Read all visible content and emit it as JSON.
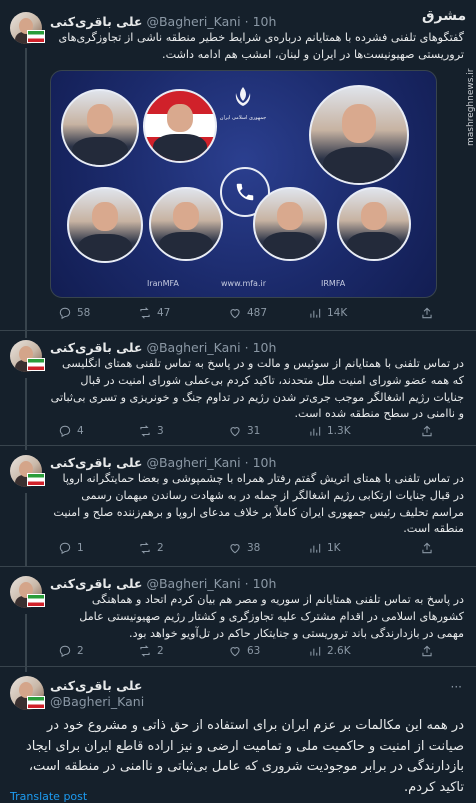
{
  "watermark": {
    "logo_text": "مشرق",
    "site": "mashreghnews.ir"
  },
  "tweets": [
    {
      "name": "علی باقری‌کنی",
      "handle": "@Bagheri_Kani",
      "time": "10h",
      "text": "گفتگوهای تلفنی فشرده با همتایانم درباره‌ی شرایط خطیر منطقه ناشی از تجاوزگری‌های تروریستی صهیونیست‌ها در ایران و لبنان، امشب هم ادامه داشت.",
      "media": {
        "social_left": "IranMFA",
        "social_mid": "www.mfa.ir",
        "social_right": "IRMFA"
      },
      "replies": "58",
      "retweets": "47",
      "likes": "487",
      "views": "14K"
    },
    {
      "name": "علی باقری‌کنی",
      "handle": "@Bagheri_Kani",
      "time": "10h",
      "text": "در تماس تلفنی با همتایانم از سوئیس و مالت و در پاسخ به تماس تلفنی همتای انگلیسی که همه عضو شورای امنیت ملل متحدند، تاکید کردم بی‌عملی شورای امنیت در قبال جنایات رژیم اشغالگر موجب جری‌تر شدن رژیم در تداوم جنگ و خونریزی و تسری بی‌ثباتی و ناامنی در سطح منطقه شده است.",
      "replies": "4",
      "retweets": "3",
      "likes": "31",
      "views": "1.3K"
    },
    {
      "name": "علی باقری‌کنی",
      "handle": "@Bagheri_Kani",
      "time": "10h",
      "text": "در تماس تلفنی با همتای اتریش گفتم رفتار همراه با چشمپوشی و بعضا حمایتگرانه اروپا در قبال جنایات ارتکابی رژیم اشغالگر از جمله در به شهادت رساندن میهمان رسمی مراسم تحلیف رئیس جمهوری ایران کاملاً بر خلاف مدعای اروپا و برهم‌زننده صلح و امنیت منطقه است.",
      "replies": "1",
      "retweets": "2",
      "likes": "38",
      "views": "1K"
    },
    {
      "name": "علی باقری‌کنی",
      "handle": "@Bagheri_Kani",
      "time": "10h",
      "text": "در پاسخ به تماس تلفنی همتایانم از سوریه و مصر هم بیان کردم اتحاد و هماهنگی کشورهای اسلامی در اقدام مشترک علیه تجاوزگری و کشتار رژیم صهیونیستی عامل مهمی در بازدارندگی باند تروریستی و جنایتکار حاکم در تل‌آویو خواهد بود.",
      "replies": "2",
      "retweets": "2",
      "likes": "63",
      "views": "2.6K"
    }
  ],
  "main_tweet": {
    "name": "علی باقری‌کنی",
    "handle": "@Bagheri_Kani",
    "text": "در همه این مکالمات بر عزم ایران برای استفاده از حق ذاتی و مشروع خود در صیانت از امنیت و حاکمیت ملی و تمامیت ارضی و نیز اراده قاطع ایران برای ایجاد بازدارندگی در برابر موجودیت شروری که عامل بی‌ثباتی و ناامنی در منطقه است، تاکید کردم.",
    "translate": "Translate post"
  },
  "colors": {
    "background": "#15202b",
    "text": "#e7e9ea",
    "secondary": "#8b98a5",
    "link": "#1d9bf0",
    "divider": "#38444d"
  }
}
